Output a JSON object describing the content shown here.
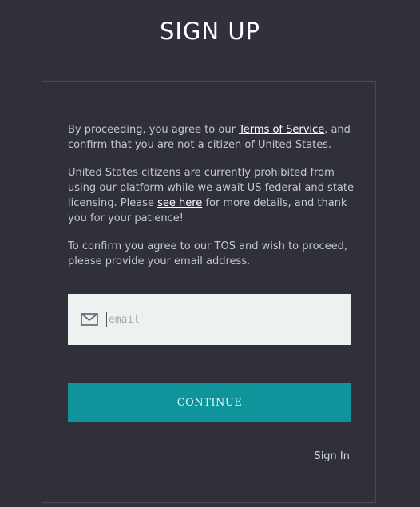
{
  "header": {
    "title": "SIGN UP"
  },
  "content": {
    "p1_before": "By proceeding, you agree to our ",
    "p1_link": "Terms of Service",
    "p1_after": ", and confirm that you are not a citizen of United States.",
    "p2_before": "United States citizens are currently prohibited from using our platform while we await US federal and state licensing. Please ",
    "p2_link": "see here",
    "p2_after": " for more details, and thank you for your patience!",
    "p3": "To confirm you agree to our TOS and wish to proceed, please provide your email address."
  },
  "form": {
    "email_placeholder": "email",
    "email_value": "",
    "continue_label": "CONTINUE",
    "signin_label": "Sign In"
  },
  "icons": {
    "email": "mail-icon"
  },
  "colors": {
    "background": "#31313c",
    "accent": "#0f949b",
    "input_background": "#edf1f1"
  }
}
